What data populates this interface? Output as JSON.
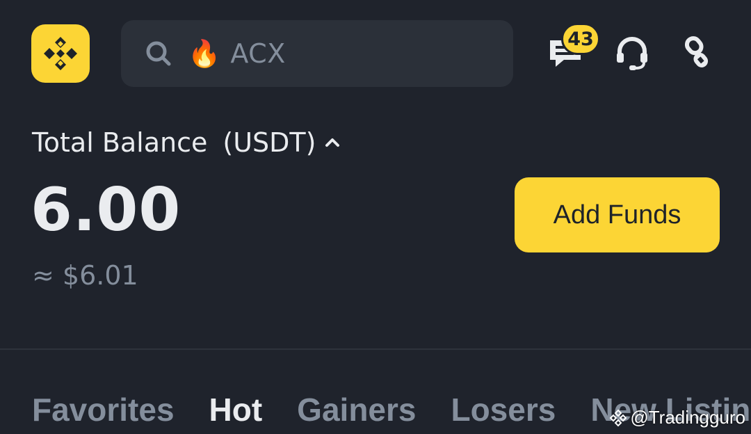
{
  "header": {
    "search": {
      "icon": "search-icon",
      "trend_icon": "fire-icon",
      "trend_emoji": "🔥",
      "placeholder": "ACX"
    },
    "messages": {
      "icon": "message-icon",
      "badge_count": "43"
    },
    "support": {
      "icon": "headset-icon"
    },
    "link": {
      "icon": "link-icon"
    }
  },
  "balance": {
    "label": "Total Balance",
    "currency": "(USDT)",
    "value": "6.00",
    "approx": "≈ $6.01",
    "add_funds_label": "Add Funds"
  },
  "tabs": [
    {
      "label": "Favorites",
      "active": false
    },
    {
      "label": "Hot",
      "active": true
    },
    {
      "label": "Gainers",
      "active": false
    },
    {
      "label": "Losers",
      "active": false
    },
    {
      "label": "New Listin",
      "active": false
    }
  ],
  "watermark": {
    "text": "@Tradingguro"
  },
  "colors": {
    "background": "#1f232c",
    "brand_yellow": "#fcd535",
    "muted_text": "#848e9c",
    "primary_text": "#eaecef"
  }
}
